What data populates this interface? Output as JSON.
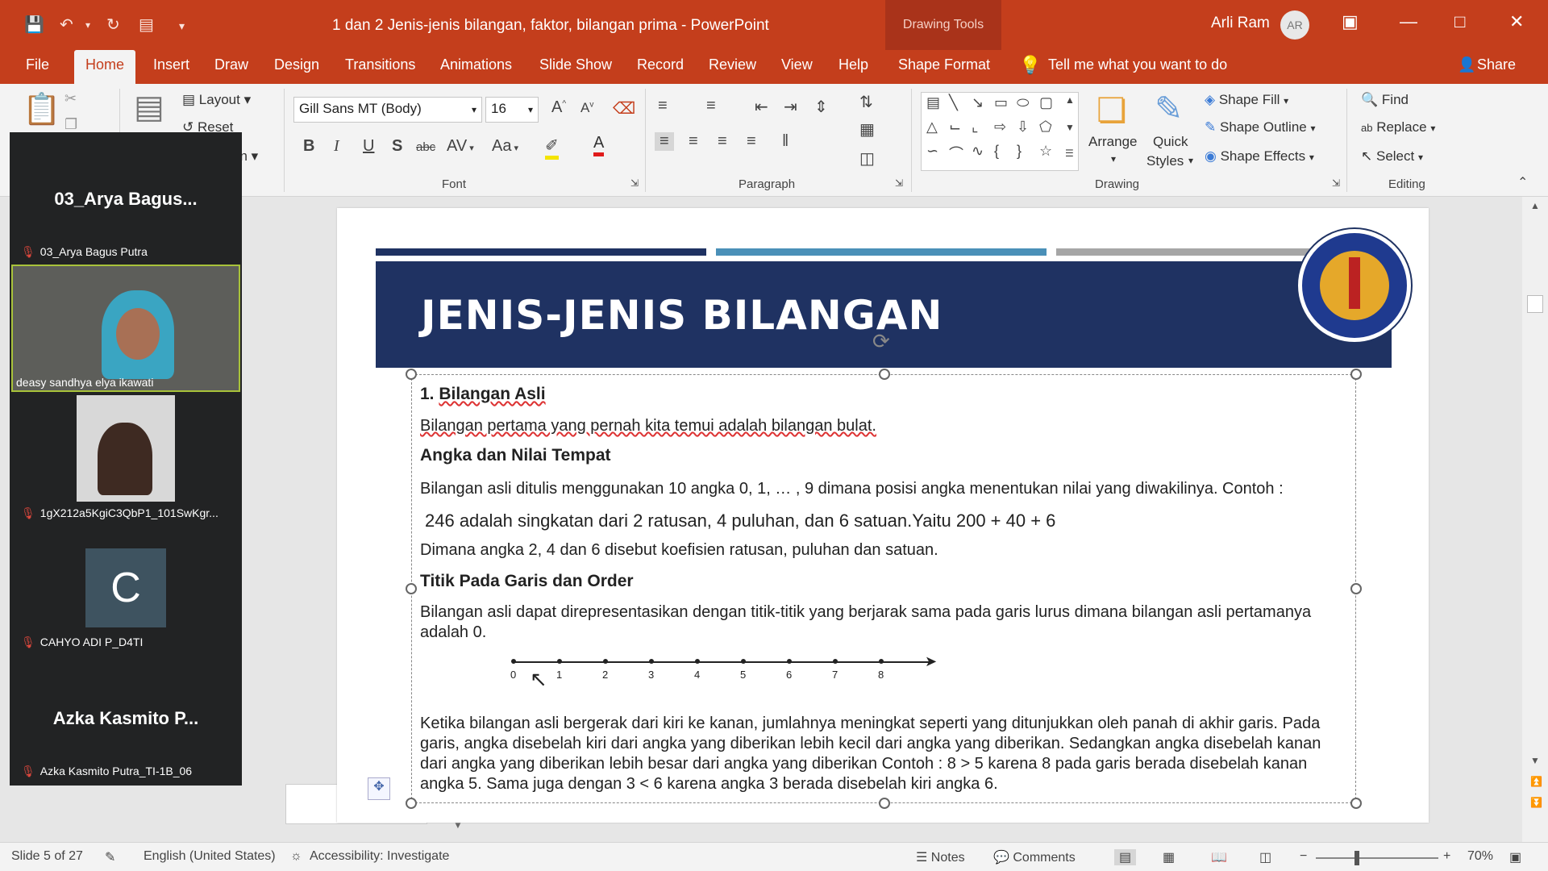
{
  "window": {
    "title": "1 dan 2 Jenis-jenis bilangan, faktor, bilangan prima  -  PowerPoint",
    "context_tools": "Drawing Tools",
    "user_name": "Arli Ram",
    "user_initials": "AR"
  },
  "tabs": [
    "File",
    "Home",
    "Insert",
    "Draw",
    "Design",
    "Transitions",
    "Animations",
    "Slide Show",
    "Record",
    "Review",
    "View",
    "Help",
    "Shape Format"
  ],
  "tell_me": "Tell me what you want to do",
  "share_label": "Share",
  "ribbon": {
    "slides": {
      "layout": "Layout",
      "reset": "Reset",
      "section": "on"
    },
    "font": {
      "name": "Gill Sans MT (Body)",
      "size": "16",
      "label": "Font"
    },
    "paragraph": {
      "label": "Paragraph"
    },
    "drawing": {
      "arrange": "Arrange",
      "quick_styles_1": "Quick",
      "quick_styles_2": "Styles",
      "shape_fill": "Shape Fill",
      "shape_outline": "Shape Outline",
      "shape_effects": "Shape Effects",
      "label": "Drawing"
    },
    "editing": {
      "find": "Find",
      "replace": "Replace",
      "select": "Select",
      "label": "Editing"
    }
  },
  "participants": [
    {
      "big_name": "03_Arya  Bagus...",
      "name": "03_Arya Bagus Putra"
    },
    {
      "name": "deasy sandhya elya ikawati"
    },
    {
      "name": "1gX212a5KgiC3QbP1_101SwKgr..."
    },
    {
      "initial": "C",
      "name": "CAHYO ADI P_D4TI"
    },
    {
      "big_name": "Azka  Kasmito  P...",
      "name": "Azka Kasmito Putra_TI-1B_06"
    }
  ],
  "slide": {
    "title": "JENIS-JENIS BILANGAN",
    "h1_num": "1.",
    "h1": "Bilangan Asli",
    "p1": "Bilangan pertama yang pernah kita temui adalah bilangan bulat.",
    "h2": "Angka dan Nilai Tempat",
    "p2": "Bilangan asli ditulis menggunakan 10 angka 0, 1, … , 9 dimana posisi angka menentukan nilai yang diwakilinya. Contoh :",
    "p3": "246 adalah singkatan dari 2 ratusan, 4 puluhan, dan 6 satuan.Yaitu 200 + 40 + 6",
    "p4": "Dimana angka 2, 4 dan 6 disebut koefisien ratusan, puluhan dan satuan.",
    "h3": "Titik Pada Garis dan Order",
    "p5": "Bilangan asli dapat direpresentasikan dengan titik-titik yang berjarak sama pada garis lurus dimana bilangan asli pertamanya adalah 0.",
    "numberline": [
      "0",
      "1",
      "2",
      "3",
      "4",
      "5",
      "6",
      "7",
      "8"
    ],
    "p6": "Ketika bilangan asli bergerak dari kiri ke kanan, jumlahnya meningkat seperti yang ditunjukkan oleh panah di akhir garis. Pada garis, angka disebelah kiri dari angka yang diberikan lebih kecil dari angka yang diberikan. Sedangkan angka disebelah kanan dari angka yang diberikan lebih besar dari angka yang diberikan Contoh : 8 > 5 karena 8 pada garis berada disebelah kanan angka 5. Sama juga dengan 3 < 6 karena angka 3 berada disebelah kiri angka 6."
  },
  "status": {
    "slide": "Slide 5 of 27",
    "language": "English (United States)",
    "accessibility": "Accessibility: Investigate",
    "notes": "Notes",
    "comments": "Comments",
    "zoom": "70%"
  },
  "colors": {
    "accent": "#c43e1c",
    "banner": "#1f3262",
    "bar1": "#1f3262",
    "bar2": "#4a90b8",
    "bar3": "#a6a6a6"
  }
}
